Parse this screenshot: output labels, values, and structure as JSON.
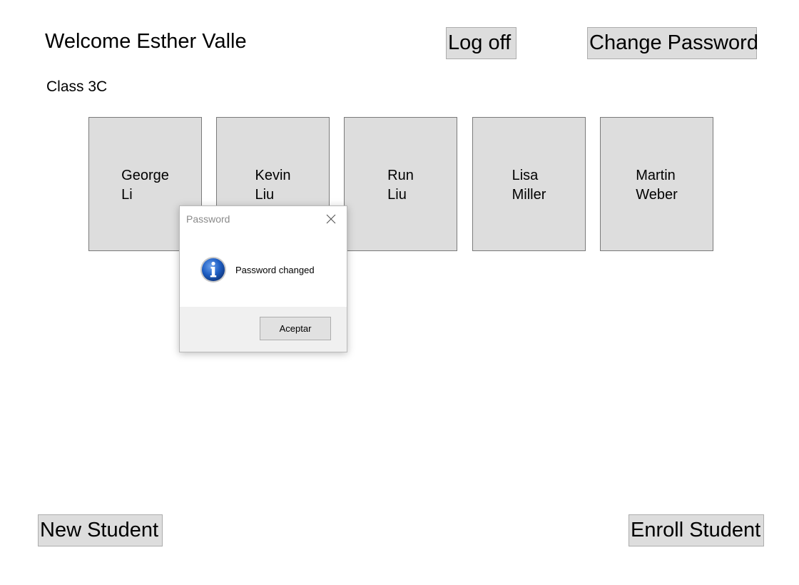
{
  "header": {
    "welcome_text": "Welcome Esther Valle",
    "class_label": "Class 3C",
    "logoff_label": "Log off",
    "change_password_label": "Change Password"
  },
  "students": [
    {
      "first": "George",
      "last": "Li"
    },
    {
      "first": "Kevin",
      "last": "Liu"
    },
    {
      "first": "Run",
      "last": "Liu"
    },
    {
      "first": "Lisa",
      "last": "Miller"
    },
    {
      "first": "Martin",
      "last": "Weber"
    }
  ],
  "footer": {
    "new_student_label": "New Student",
    "enroll_student_label": "Enroll Student"
  },
  "dialog": {
    "title": "Password",
    "message": "Password changed",
    "ok_label": "Aceptar",
    "icon": "info-icon",
    "close_icon": "close-icon"
  },
  "colors": {
    "button_bg": "#dddddd",
    "card_bg": "#dddddd",
    "dialog_footer_bg": "#f0f0f0",
    "info_icon_blue": "#1f5fc4"
  }
}
